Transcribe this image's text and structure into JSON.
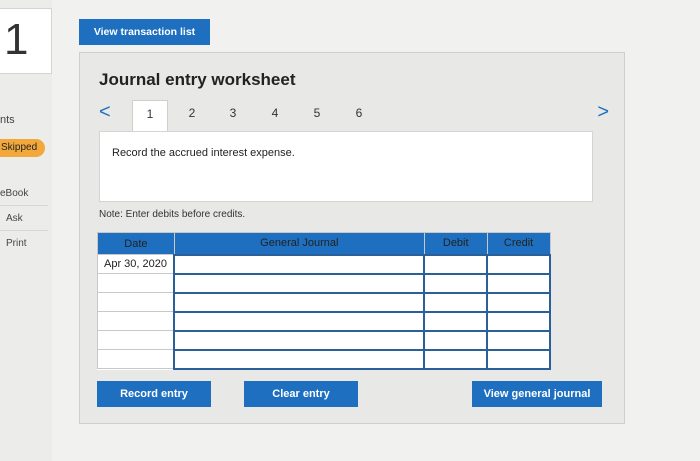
{
  "question": {
    "number": "1"
  },
  "side": {
    "points_label": "nts",
    "status_badge": "Skipped",
    "ebook": "eBook",
    "ask": "Ask",
    "print": "Print"
  },
  "top_button": "View transaction list",
  "worksheet": {
    "title": "Journal entry worksheet",
    "prev": "<",
    "next": ">",
    "tabs": [
      "1",
      "2",
      "3",
      "4",
      "5",
      "6"
    ],
    "active_tab": "1",
    "prompt": "Record the accrued interest expense.",
    "note": "Note: Enter debits before credits."
  },
  "table": {
    "headers": {
      "date": "Date",
      "general_journal": "General Journal",
      "debit": "Debit",
      "credit": "Credit"
    },
    "rows": [
      {
        "date": "Apr 30, 2020",
        "account": "",
        "debit": "",
        "credit": ""
      },
      {
        "date": "",
        "account": "",
        "debit": "",
        "credit": ""
      },
      {
        "date": "",
        "account": "",
        "debit": "",
        "credit": ""
      },
      {
        "date": "",
        "account": "",
        "debit": "",
        "credit": ""
      },
      {
        "date": "",
        "account": "",
        "debit": "",
        "credit": ""
      },
      {
        "date": "",
        "account": "",
        "debit": "",
        "credit": ""
      }
    ]
  },
  "buttons": {
    "record": "Record entry",
    "clear": "Clear entry",
    "view_general_journal": "View general journal"
  },
  "colors": {
    "primary": "#1e6fbf",
    "badge": "#f3a83b"
  }
}
